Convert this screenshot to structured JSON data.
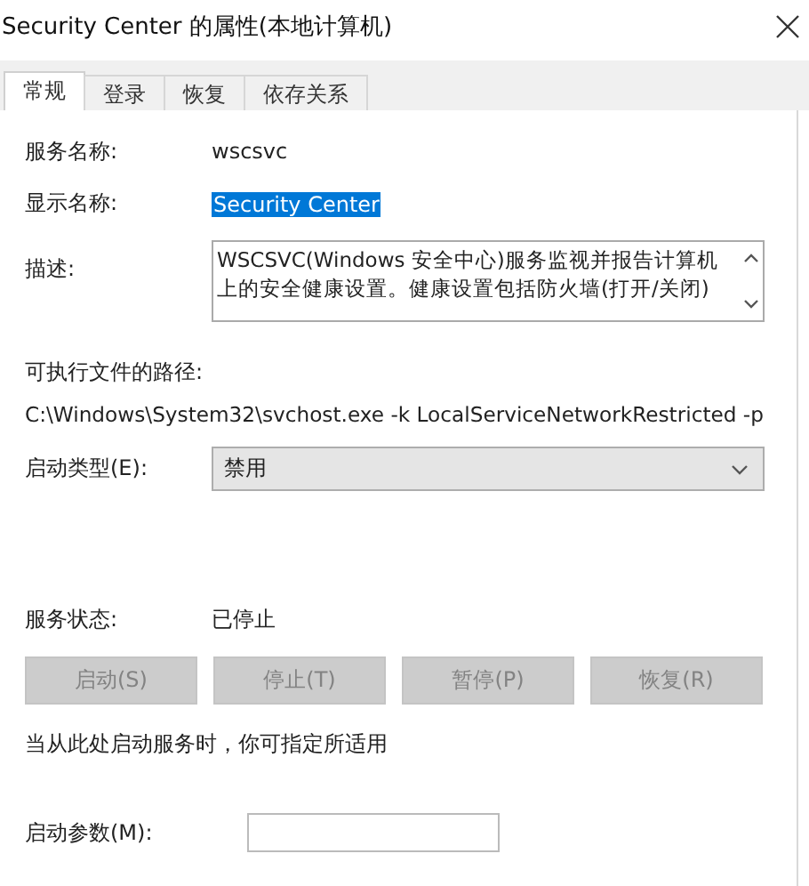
{
  "window": {
    "title": "Security Center 的属性(本地计算机)"
  },
  "tabs": [
    {
      "label": "常规",
      "selected": true
    },
    {
      "label": "登录",
      "selected": false
    },
    {
      "label": "恢复",
      "selected": false
    },
    {
      "label": "依存关系",
      "selected": false
    }
  ],
  "service_name": {
    "label": "服务名称:",
    "value": "wscsvc"
  },
  "display_name": {
    "label": "显示名称:",
    "value": "Security Center",
    "selected": true
  },
  "description": {
    "label": "描述:",
    "lines": [
      "WSCSVC(Windows 安全中心)服务监视并报告计算机",
      "上的安全健康设置。健康设置包括防火墙(打开/关闭)"
    ]
  },
  "executable_path": {
    "label": "可执行文件的路径:",
    "value": "C:\\Windows\\System32\\svchost.exe -k LocalServiceNetworkRestricted -p"
  },
  "startup_type": {
    "label": "启动类型(E):",
    "value": "禁用"
  },
  "service_status": {
    "label": "服务状态:",
    "value": "已停止"
  },
  "buttons": [
    {
      "label": "启动(S)",
      "disabled": true
    },
    {
      "label": "停止(T)",
      "disabled": true
    },
    {
      "label": "暂停(P)",
      "disabled": true
    },
    {
      "label": "恢复(R)",
      "disabled": true
    }
  ],
  "hint": "当从此处启动服务时，你可指定所适用",
  "start_parameters": {
    "label": "启动参数(M):"
  }
}
